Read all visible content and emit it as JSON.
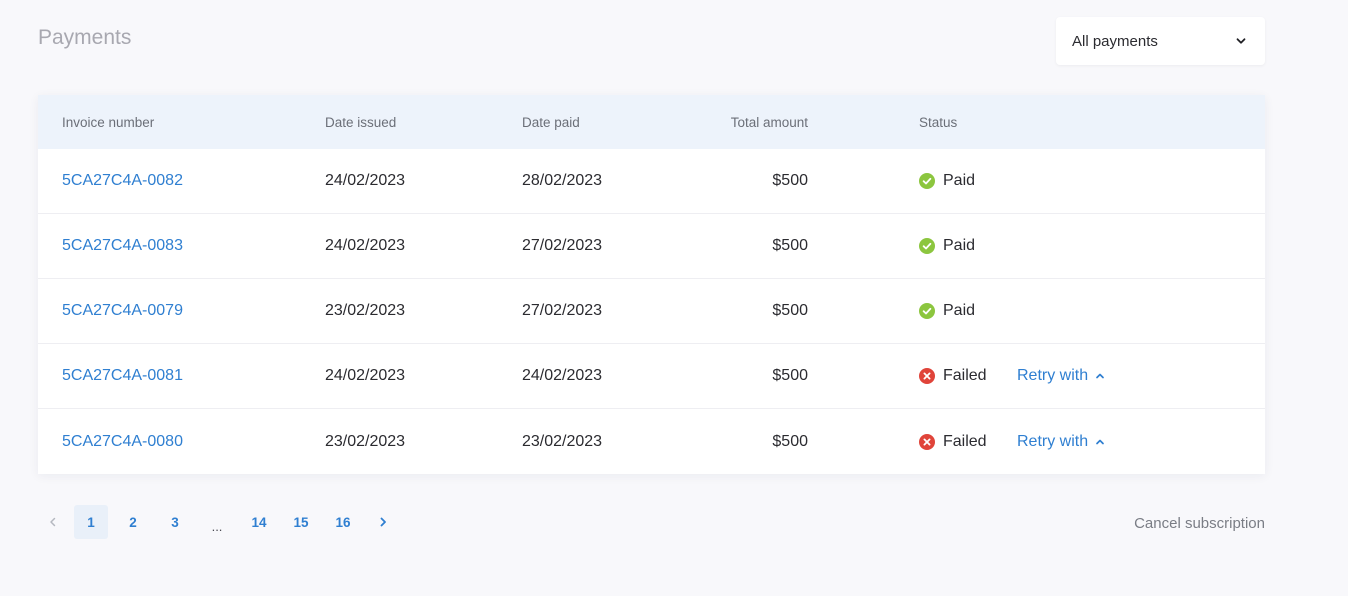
{
  "page": {
    "title": "Payments"
  },
  "filter": {
    "selected": "All payments"
  },
  "table": {
    "headers": {
      "invoice": "Invoice number",
      "issued": "Date issued",
      "paid": "Date paid",
      "amount": "Total amount",
      "status": "Status"
    },
    "rows": [
      {
        "invoice": "5CA27C4A-0082",
        "issued": "24/02/2023",
        "paid": "28/02/2023",
        "amount": "$500",
        "status": "Paid",
        "status_icon": "check-circle-icon",
        "retry": ""
      },
      {
        "invoice": "5CA27C4A-0083",
        "issued": "24/02/2023",
        "paid": "27/02/2023",
        "amount": "$500",
        "status": "Paid",
        "status_icon": "check-circle-icon",
        "retry": ""
      },
      {
        "invoice": "5CA27C4A-0079",
        "issued": "23/02/2023",
        "paid": "27/02/2023",
        "amount": "$500",
        "status": "Paid",
        "status_icon": "check-circle-icon",
        "retry": ""
      },
      {
        "invoice": "5CA27C4A-0081",
        "issued": "24/02/2023",
        "paid": "24/02/2023",
        "amount": "$500",
        "status": "Failed",
        "status_icon": "x-circle-icon",
        "retry": "Retry with"
      },
      {
        "invoice": "5CA27C4A-0080",
        "issued": "23/02/2023",
        "paid": "23/02/2023",
        "amount": "$500",
        "status": "Failed",
        "status_icon": "x-circle-icon",
        "retry": "Retry with"
      }
    ]
  },
  "pagination": {
    "pages_before": [
      "1",
      "2",
      "3"
    ],
    "ellipsis": "...",
    "pages_after": [
      "14",
      "15",
      "16"
    ],
    "current": "1"
  },
  "footer": {
    "cancel_label": "Cancel subscription"
  },
  "colors": {
    "accent": "#2f7fd1",
    "paid": "#8cc63f",
    "failed": "#e0443a",
    "header_bg": "#edf3fb"
  }
}
